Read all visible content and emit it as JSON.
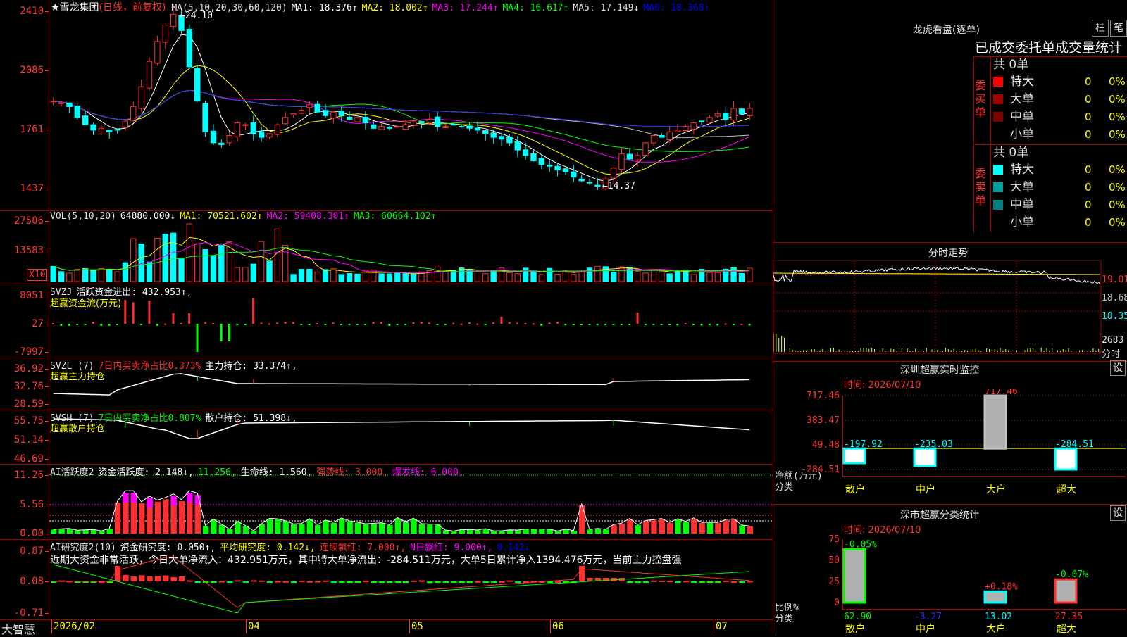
{
  "stock": {
    "title": "★雪龙集团",
    "mode": "(日线，前复权)"
  },
  "ma_header": [
    {
      "text": "MA(5,10,20,30,60,120)",
      "color": "#e0e0e0"
    },
    {
      "text": "MA1: 18.376↑",
      "color": "#ffffff"
    },
    {
      "text": "MA2: 18.002↑",
      "color": "#ffff00"
    },
    {
      "text": "MA3: 17.244↑",
      "color": "#ff00ff"
    },
    {
      "text": "MA4: 16.617↑",
      "color": "#00ff00"
    },
    {
      "text": "MA5: 17.149↓",
      "color": "#e0e0e0"
    },
    {
      "text": "MA6: 18.368↑",
      "color": "#0000ff"
    }
  ],
  "price_axis": [
    "2410",
    "2086",
    "1761",
    "1437"
  ],
  "price_marks": {
    "high": "24.10",
    "low": "14.37"
  },
  "vol": {
    "header": [
      {
        "text": "VOL(5,10,20)",
        "color": "#e0e0e0"
      },
      {
        "text": "64880.000↓",
        "color": "#ffffff"
      },
      {
        "text": "MA1: 70521.602↑",
        "color": "#ffff00"
      },
      {
        "text": "MA2: 59408.301↑",
        "color": "#ff00ff"
      },
      {
        "text": "MA3: 60664.102↑",
        "color": "#00ff00"
      }
    ],
    "axis": [
      "27506",
      "13583"
    ],
    "unit": "X10"
  },
  "svzj": {
    "header1": [
      {
        "text": "SVZJ",
        "color": "#e0e0e0"
      },
      {
        "text": "活跃资金进出: 432.953↑,",
        "color": "#ffffff"
      }
    ],
    "header2": "超赢资金流(万元)",
    "axis": [
      "8051",
      "27",
      "-7997"
    ]
  },
  "svzl": {
    "header1": [
      {
        "text": "SVZL (7)",
        "color": "#e0e0e0"
      },
      {
        "text": "7日内买卖净占比0.373%",
        "color": "#ff3030"
      },
      {
        "text": "主力持仓: 33.374↑,",
        "color": "#ffffff"
      }
    ],
    "header2": "超赢主力持仓",
    "axis": [
      "36.92",
      "32.76",
      "28.59"
    ]
  },
  "svsh": {
    "header1": [
      {
        "text": "SVSH (7)",
        "color": "#e0e0e0"
      },
      {
        "text": "7日内买卖净占比0.807%",
        "color": "#00ff00"
      },
      {
        "text": "散户持仓: 51.398↓,",
        "color": "#ffffff"
      }
    ],
    "header2": "超赢散户持仓",
    "axis": [
      "55.75",
      "51.14",
      "46.69"
    ]
  },
  "ai_active": {
    "header": [
      {
        "text": "AI活跃度2",
        "color": "#e0e0e0"
      },
      {
        "text": "资金活跃度: 2.148↓,",
        "color": "#ffffff"
      },
      {
        "text": "11.256,",
        "color": "#00ff00"
      },
      {
        "text": "生命线: 1.560,",
        "color": "#ffffff"
      },
      {
        "text": "强势线: 3.000,",
        "color": "#ff3030"
      },
      {
        "text": "爆发线: 6.000,",
        "color": "#ff00ff"
      }
    ],
    "axis": [
      "11.26",
      "5.56",
      "0.00"
    ]
  },
  "ai_research": {
    "header": [
      {
        "text": "AI研究度2(10)",
        "color": "#e0e0e0"
      },
      {
        "text": "资金研究度: 0.050↑,",
        "color": "#ffffff"
      },
      {
        "text": "平均研究度: 0.142↓,",
        "color": "#ffff00"
      },
      {
        "text": "连续飘红: 7.000↑,",
        "color": "#ff3030"
      },
      {
        "text": "N日飘红: 9.000↑,",
        "color": "#ff00ff"
      },
      {
        "text": "0.142↓",
        "color": "#0000ff"
      }
    ],
    "note": "近期大资金非常活跃，今日大单净流入：432.951万元，其中特大单净流出：-284.511万元，大单5日累计净入1394.476万元，当前主力控盘强",
    "axis": [
      "0.87",
      "0.08",
      "-0.71"
    ]
  },
  "bottom": {
    "brand": "大智慧",
    "dates": [
      {
        "label": "2026/02"
      },
      {
        "label": "04"
      },
      {
        "label": "05"
      },
      {
        "label": "06"
      },
      {
        "label": "07"
      }
    ]
  },
  "lhb": {
    "title": "龙虎看盘(逐单)",
    "btn1": "柱",
    "btn2": "笔",
    "subtitle": "已成交委托单成交量统计",
    "buy_label": "委买单",
    "sell_label": "委卖单",
    "buy_total": "共 0单",
    "sell_total": "共 0单",
    "rows": [
      {
        "name": "特大",
        "count": "0",
        "pct": "0%",
        "color": "#ff0000"
      },
      {
        "name": "大单",
        "count": "0",
        "pct": "0%",
        "color": "#a00000"
      },
      {
        "name": "中单",
        "count": "0",
        "pct": "0%",
        "color": "#800000"
      },
      {
        "name": "小单",
        "count": "0",
        "pct": "0%",
        "color": ""
      }
    ],
    "sell_rows": [
      {
        "name": "特大",
        "count": "0",
        "pct": "0%",
        "color": "#00ffff"
      },
      {
        "name": "大单",
        "count": "0",
        "pct": "0%",
        "color": "#00a0a0"
      },
      {
        "name": "中单",
        "count": "0",
        "pct": "0%",
        "color": "#008080"
      },
      {
        "name": "小单",
        "count": "0",
        "pct": "0%",
        "color": ""
      }
    ]
  },
  "intraday": {
    "title": "分时走势",
    "prices": [
      "19.01",
      "18.68",
      "18.35"
    ],
    "vol": "2683",
    "vol_unit": "分时"
  },
  "sz_monitor": {
    "title": "深圳超赢实时监控",
    "settings": "设",
    "time": "时间: 2026/07/10",
    "axis": [
      "717.46",
      "383.47",
      "49.48",
      "-284.51"
    ],
    "ylabel": "净额(万元)",
    "xlabel": "分类",
    "categories": [
      "散户",
      "中户",
      "大户",
      "超大"
    ],
    "values": [
      -197.92,
      -235.03,
      717.46,
      -284.51
    ],
    "value_labels": [
      "-197.92",
      "-235.03",
      "717.46",
      "-284.51"
    ]
  },
  "sz_class": {
    "title": "深市超赢分类统计",
    "settings": "设",
    "time": "时间: 2026/07/10",
    "axis": [
      "75",
      "50",
      "25",
      "0"
    ],
    "ylabel": "比例%",
    "xlabel": "分类",
    "categories": [
      "散户",
      "中户",
      "大户",
      "超大"
    ],
    "values": [
      62.9,
      -3.27,
      13.02,
      27.35
    ],
    "value_labels": [
      "62.90",
      "-3.27",
      "13.02",
      "27.35"
    ],
    "change_labels": [
      "-0.05%",
      "",
      "+0.18%",
      "-0.07%"
    ]
  },
  "chart_data": [
    {
      "type": "bar",
      "title": "深圳超赢实时监控",
      "categories": [
        "散户",
        "中户",
        "大户",
        "超大"
      ],
      "series": [
        {
          "values": [
            -197.92,
            -235.03,
            717.46,
            -284.51
          ]
        }
      ],
      "ylabel": "净额(万元)",
      "xlabel": "分类",
      "ylim": [
        -284.51,
        717.46
      ]
    },
    {
      "type": "bar",
      "title": "深市超赢分类统计",
      "categories": [
        "散户",
        "中户",
        "大户",
        "超大"
      ],
      "series": [
        {
          "values": [
            62.9,
            -3.27,
            13.02,
            27.35
          ]
        }
      ],
      "ylabel": "比例%",
      "xlabel": "分类",
      "ylim": [
        0,
        75
      ]
    }
  ]
}
